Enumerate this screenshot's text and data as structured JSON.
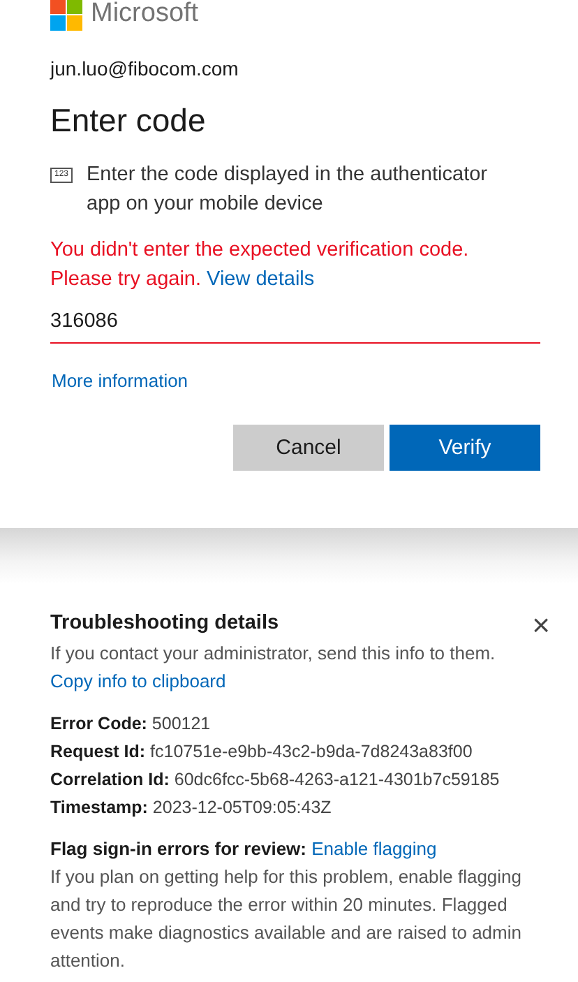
{
  "brand": {
    "name": "Microsoft"
  },
  "account": "jun.luo@fibocom.com",
  "title": "Enter code",
  "instruction": {
    "icon_text": "123",
    "text": "Enter the code displayed in the authenticator app on your mobile device"
  },
  "error": {
    "text": "You didn't enter the expected verification code. Please try again.",
    "link": "View details"
  },
  "code_field": {
    "value": "316086",
    "invalid": true
  },
  "more_info_link": "More information",
  "buttons": [
    {
      "label": "Cancel",
      "kind": "secondary"
    },
    {
      "label": "Verify",
      "kind": "primary"
    }
  ],
  "troubleshooting": {
    "title": "Troubleshooting details",
    "close": "×",
    "intro": "If you contact your administrator, send this info to them.",
    "copy_link": "Copy info to clipboard",
    "details": [
      "**Error Code:** 500121",
      "**Request Id:** fc10751e-e9bb-43c2-b9da-7d8243a83f00",
      "**Correlation Id:** 60dc6fcc-5b68-4263-a121-4301b7c59185",
      "**Timestamp:** 2023-12-05T09:05:43Z"
    ],
    "flag_label": "Flag sign-in errors for review:",
    "flag_link": "Enable flagging",
    "flag_text": "If you plan on getting help for this problem, enable flagging and try to reproduce the error within 20 minutes. Flagged events make diagnostics available and are raised to admin attention."
  }
}
